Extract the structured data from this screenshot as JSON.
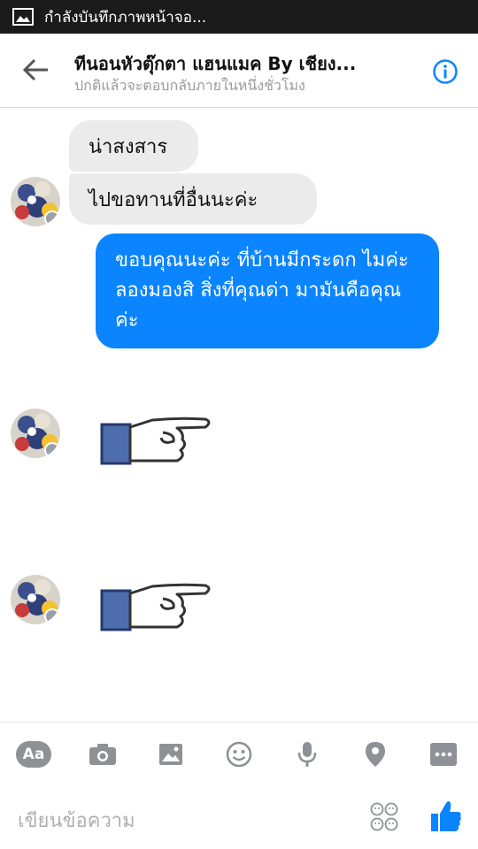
{
  "status_bar": {
    "notification_text": "กำลังบันทึกภาพหน้าจอ..."
  },
  "header": {
    "title": "ทีนอนหัวตุ๊กตา แฮนแมค By เชียง...",
    "subtitle": "ปกติแล้วจะตอบกลับภายในหนึ่งชั่วโมง"
  },
  "messages": {
    "incoming_1": "น่าสงสาร",
    "incoming_2": "ไปขอทานที่อื่นนะค่ะ",
    "outgoing_1": "ขอบคุณนะค่ะ ที่บ้านมีกระดก ไมค่ะ ลองมองสิ สิ่งที่คุณด่า มามันคือคุณค่ะ"
  },
  "composer": {
    "aa_label": "Aa",
    "placeholder": "เขียนข้อความ"
  },
  "colors": {
    "accent": "#0a84ff",
    "incoming_bubble": "#ebebeb",
    "status_bar": "#1a1a1a",
    "tool_icon": "#8e9196"
  }
}
